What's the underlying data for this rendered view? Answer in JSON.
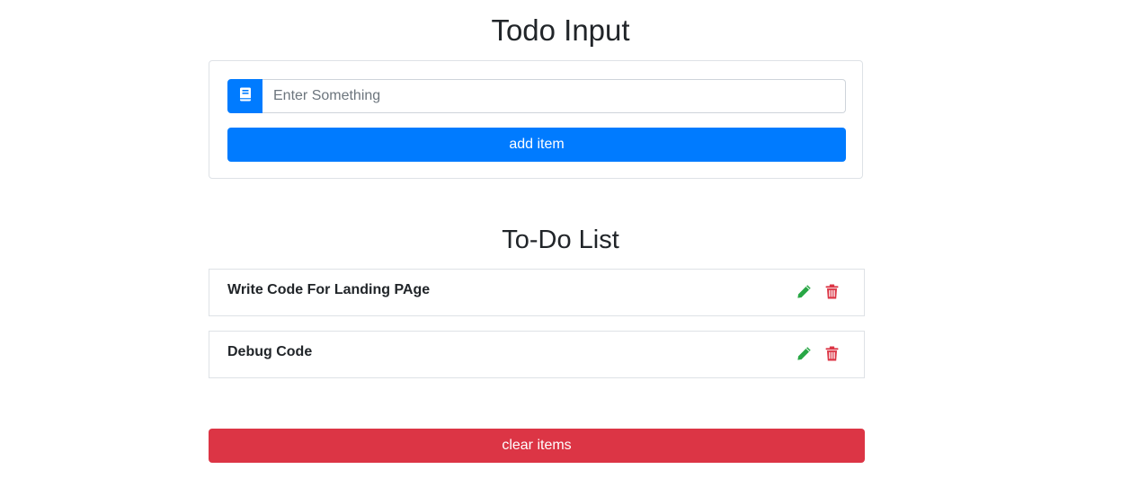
{
  "input_section": {
    "title": "Todo Input",
    "prefix_icon": "book-icon",
    "placeholder": "Enter Something",
    "value": "",
    "add_button_label": "add item"
  },
  "list_section": {
    "title": "To-Do List",
    "items": [
      {
        "label": "Write Code For Landing PAge",
        "edit_icon": "pencil-icon",
        "delete_icon": "trash-icon"
      },
      {
        "label": "Debug Code",
        "edit_icon": "pencil-icon",
        "delete_icon": "trash-icon"
      }
    ],
    "clear_button_label": "clear items"
  },
  "colors": {
    "primary": "#007bff",
    "danger": "#dc3545",
    "success": "#28a745",
    "border": "#dee2e6",
    "text": "#212529"
  }
}
